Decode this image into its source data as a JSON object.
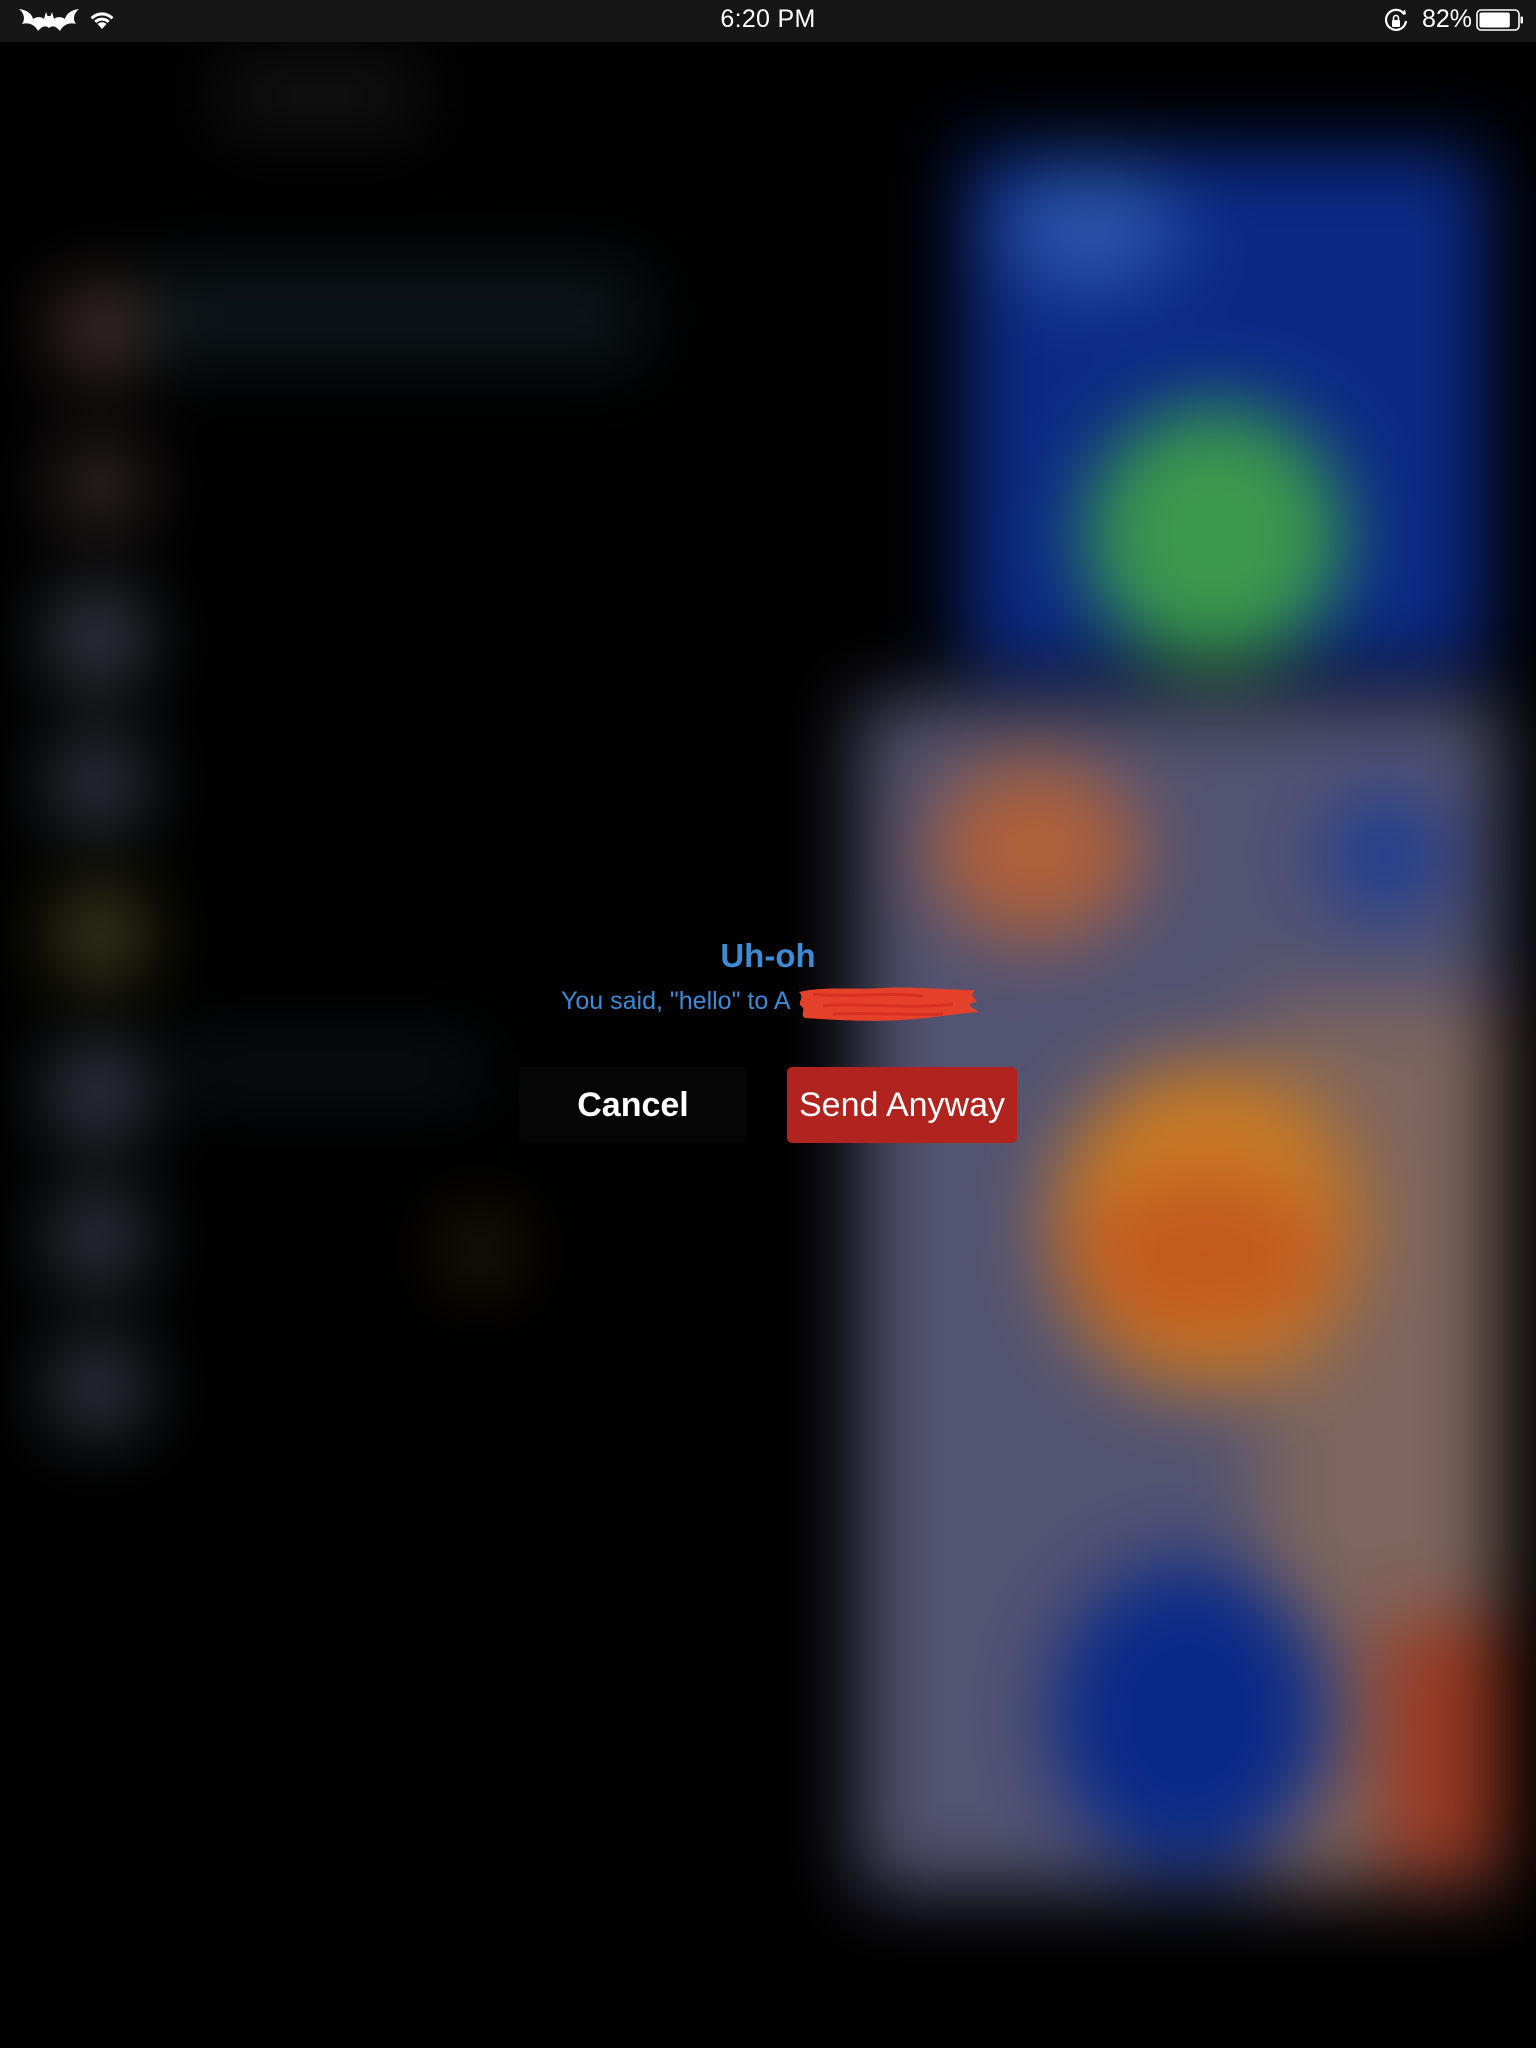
{
  "status_bar": {
    "time": "6:20 PM",
    "battery_percent": "82%",
    "battery_level": 0.82,
    "icons": [
      "bat-logo-icon",
      "wifi-icon",
      "rotation-lock-icon",
      "battery-icon"
    ]
  },
  "alert": {
    "title": "Uh-oh",
    "message": "You said, \"hello\" to A",
    "cancel_label": "Cancel",
    "send_label": "Send Anyway"
  },
  "colors": {
    "alert_text": "#3d8ad6",
    "send_button": "#b0231f",
    "redaction": "#e5412a"
  }
}
